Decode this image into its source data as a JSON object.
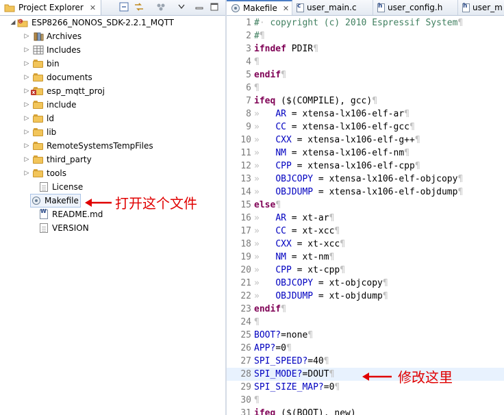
{
  "explorer": {
    "title": "Project Explorer",
    "project": "ESP8266_NONOS_SDK-2.2.1_MQTT",
    "items": [
      {
        "label": "Archives",
        "icon": "archives-icon",
        "expandable": true
      },
      {
        "label": "Includes",
        "icon": "includes-icon",
        "expandable": true
      },
      {
        "label": "bin",
        "icon": "folder-icon",
        "expandable": true
      },
      {
        "label": "documents",
        "icon": "folder-icon",
        "expandable": true
      },
      {
        "label": "esp_mqtt_proj",
        "icon": "source-folder-error-icon",
        "expandable": true
      },
      {
        "label": "include",
        "icon": "folder-icon",
        "expandable": true
      },
      {
        "label": "ld",
        "icon": "folder-icon",
        "expandable": true
      },
      {
        "label": "lib",
        "icon": "folder-icon",
        "expandable": true
      },
      {
        "label": "RemoteSystemsTempFiles",
        "icon": "folder-icon",
        "expandable": true
      },
      {
        "label": "third_party",
        "icon": "folder-icon",
        "expandable": true
      },
      {
        "label": "tools",
        "icon": "folder-icon",
        "expandable": true
      },
      {
        "label": "License",
        "icon": "file-icon",
        "expandable": false
      },
      {
        "label": "Makefile",
        "icon": "makefile-icon",
        "expandable": false
      },
      {
        "label": "README.md",
        "icon": "markdown-file-icon",
        "expandable": false
      },
      {
        "label": "VERSION",
        "icon": "file-icon",
        "expandable": false
      }
    ]
  },
  "annotations": {
    "open_file": "打开这个文件",
    "modify_here": "修改这里"
  },
  "editor": {
    "tabs": [
      {
        "label": "Makefile",
        "active": true
      },
      {
        "label": "user_main.c",
        "active": false
      },
      {
        "label": "user_config.h",
        "active": false
      },
      {
        "label": "user_m",
        "active": false
      }
    ],
    "lines": [
      {
        "n": "1",
        "segs": [
          [
            "c",
            "#"
          ],
          [
            "ws",
            "·"
          ],
          [
            "c",
            " copyright (c) 2010 Espressif System"
          ],
          [
            "ws",
            "¶"
          ]
        ]
      },
      {
        "n": "2",
        "segs": [
          [
            "c",
            "#"
          ],
          [
            "ws",
            "¶"
          ]
        ]
      },
      {
        "n": "3",
        "segs": [
          [
            "k",
            "ifndef"
          ],
          [
            "t",
            " PDIR"
          ],
          [
            "ws",
            "¶"
          ]
        ]
      },
      {
        "n": "4",
        "segs": [
          [
            "ws",
            "¶"
          ]
        ]
      },
      {
        "n": "5",
        "segs": [
          [
            "k",
            "endif"
          ],
          [
            "ws",
            "¶"
          ]
        ]
      },
      {
        "n": "6",
        "segs": [
          [
            "ws",
            "¶"
          ]
        ]
      },
      {
        "n": "7",
        "segs": [
          [
            "k",
            "ifeq"
          ],
          [
            "t",
            " ($(COMPILE), gcc)"
          ],
          [
            "ws",
            "¶"
          ]
        ]
      },
      {
        "n": "8",
        "segs": [
          [
            "ws",
            "»   "
          ],
          [
            "v",
            "AR"
          ],
          [
            "t",
            " = xtensa-lx106-elf-ar"
          ],
          [
            "ws",
            "¶"
          ]
        ]
      },
      {
        "n": "9",
        "segs": [
          [
            "ws",
            "»   "
          ],
          [
            "v",
            "CC"
          ],
          [
            "t",
            " = xtensa-lx106-elf-gcc"
          ],
          [
            "ws",
            "¶"
          ]
        ]
      },
      {
        "n": "10",
        "segs": [
          [
            "ws",
            "»   "
          ],
          [
            "v",
            "CXX"
          ],
          [
            "t",
            " = xtensa-lx106-elf-g++"
          ],
          [
            "ws",
            "¶"
          ]
        ]
      },
      {
        "n": "11",
        "segs": [
          [
            "ws",
            "»   "
          ],
          [
            "v",
            "NM"
          ],
          [
            "t",
            " = xtensa-lx106-elf-nm"
          ],
          [
            "ws",
            "¶"
          ]
        ]
      },
      {
        "n": "12",
        "segs": [
          [
            "ws",
            "»   "
          ],
          [
            "v",
            "CPP"
          ],
          [
            "t",
            " = xtensa-lx106-elf-cpp"
          ],
          [
            "ws",
            "¶"
          ]
        ]
      },
      {
        "n": "13",
        "segs": [
          [
            "ws",
            "»   "
          ],
          [
            "v",
            "OBJCOPY"
          ],
          [
            "t",
            " = xtensa-lx106-elf-objcopy"
          ],
          [
            "ws",
            "¶"
          ]
        ]
      },
      {
        "n": "14",
        "segs": [
          [
            "ws",
            "»   "
          ],
          [
            "v",
            "OBJDUMP"
          ],
          [
            "t",
            " = xtensa-lx106-elf-objdump"
          ],
          [
            "ws",
            "¶"
          ]
        ]
      },
      {
        "n": "15",
        "segs": [
          [
            "k",
            "else"
          ],
          [
            "ws",
            "¶"
          ]
        ]
      },
      {
        "n": "16",
        "segs": [
          [
            "ws",
            "»   "
          ],
          [
            "v",
            "AR"
          ],
          [
            "t",
            " = xt-ar"
          ],
          [
            "ws",
            "¶"
          ]
        ]
      },
      {
        "n": "17",
        "segs": [
          [
            "ws",
            "»   "
          ],
          [
            "v",
            "CC"
          ],
          [
            "t",
            " = xt-xcc"
          ],
          [
            "ws",
            "¶"
          ]
        ]
      },
      {
        "n": "18",
        "segs": [
          [
            "ws",
            "»   "
          ],
          [
            "v",
            "CXX"
          ],
          [
            "t",
            " = xt-xcc"
          ],
          [
            "ws",
            "¶"
          ]
        ]
      },
      {
        "n": "19",
        "segs": [
          [
            "ws",
            "»   "
          ],
          [
            "v",
            "NM"
          ],
          [
            "t",
            " = xt-nm"
          ],
          [
            "ws",
            "¶"
          ]
        ]
      },
      {
        "n": "20",
        "segs": [
          [
            "ws",
            "»   "
          ],
          [
            "v",
            "CPP"
          ],
          [
            "t",
            " = xt-cpp"
          ],
          [
            "ws",
            "¶"
          ]
        ]
      },
      {
        "n": "21",
        "segs": [
          [
            "ws",
            "»   "
          ],
          [
            "v",
            "OBJCOPY"
          ],
          [
            "t",
            " = xt-objcopy"
          ],
          [
            "ws",
            "¶"
          ]
        ]
      },
      {
        "n": "22",
        "segs": [
          [
            "ws",
            "»   "
          ],
          [
            "v",
            "OBJDUMP"
          ],
          [
            "t",
            " = xt-objdump"
          ],
          [
            "ws",
            "¶"
          ]
        ]
      },
      {
        "n": "23",
        "segs": [
          [
            "k",
            "endif"
          ],
          [
            "ws",
            "¶"
          ]
        ]
      },
      {
        "n": "24",
        "segs": [
          [
            "ws",
            "¶"
          ]
        ]
      },
      {
        "n": "25",
        "segs": [
          [
            "v",
            "BOOT?"
          ],
          [
            "t",
            "=none"
          ],
          [
            "ws",
            "¶"
          ]
        ]
      },
      {
        "n": "26",
        "segs": [
          [
            "v",
            "APP?"
          ],
          [
            "t",
            "=0"
          ],
          [
            "ws",
            "¶"
          ]
        ]
      },
      {
        "n": "27",
        "segs": [
          [
            "v",
            "SPI_SPEED?"
          ],
          [
            "t",
            "=40"
          ],
          [
            "ws",
            "¶"
          ]
        ]
      },
      {
        "n": "28",
        "segs": [
          [
            "v",
            "SPI_MODE?"
          ],
          [
            "t",
            "=DOUT"
          ],
          [
            "ws",
            "¶"
          ]
        ],
        "current": true
      },
      {
        "n": "29",
        "segs": [
          [
            "v",
            "SPI_SIZE_MAP?"
          ],
          [
            "t",
            "=0"
          ],
          [
            "ws",
            "¶"
          ]
        ]
      },
      {
        "n": "30",
        "segs": [
          [
            "ws",
            "¶"
          ]
        ]
      },
      {
        "n": "31",
        "segs": [
          [
            "k",
            "ifeq"
          ],
          [
            "t",
            " ($(BOOT), new)"
          ]
        ]
      }
    ]
  }
}
